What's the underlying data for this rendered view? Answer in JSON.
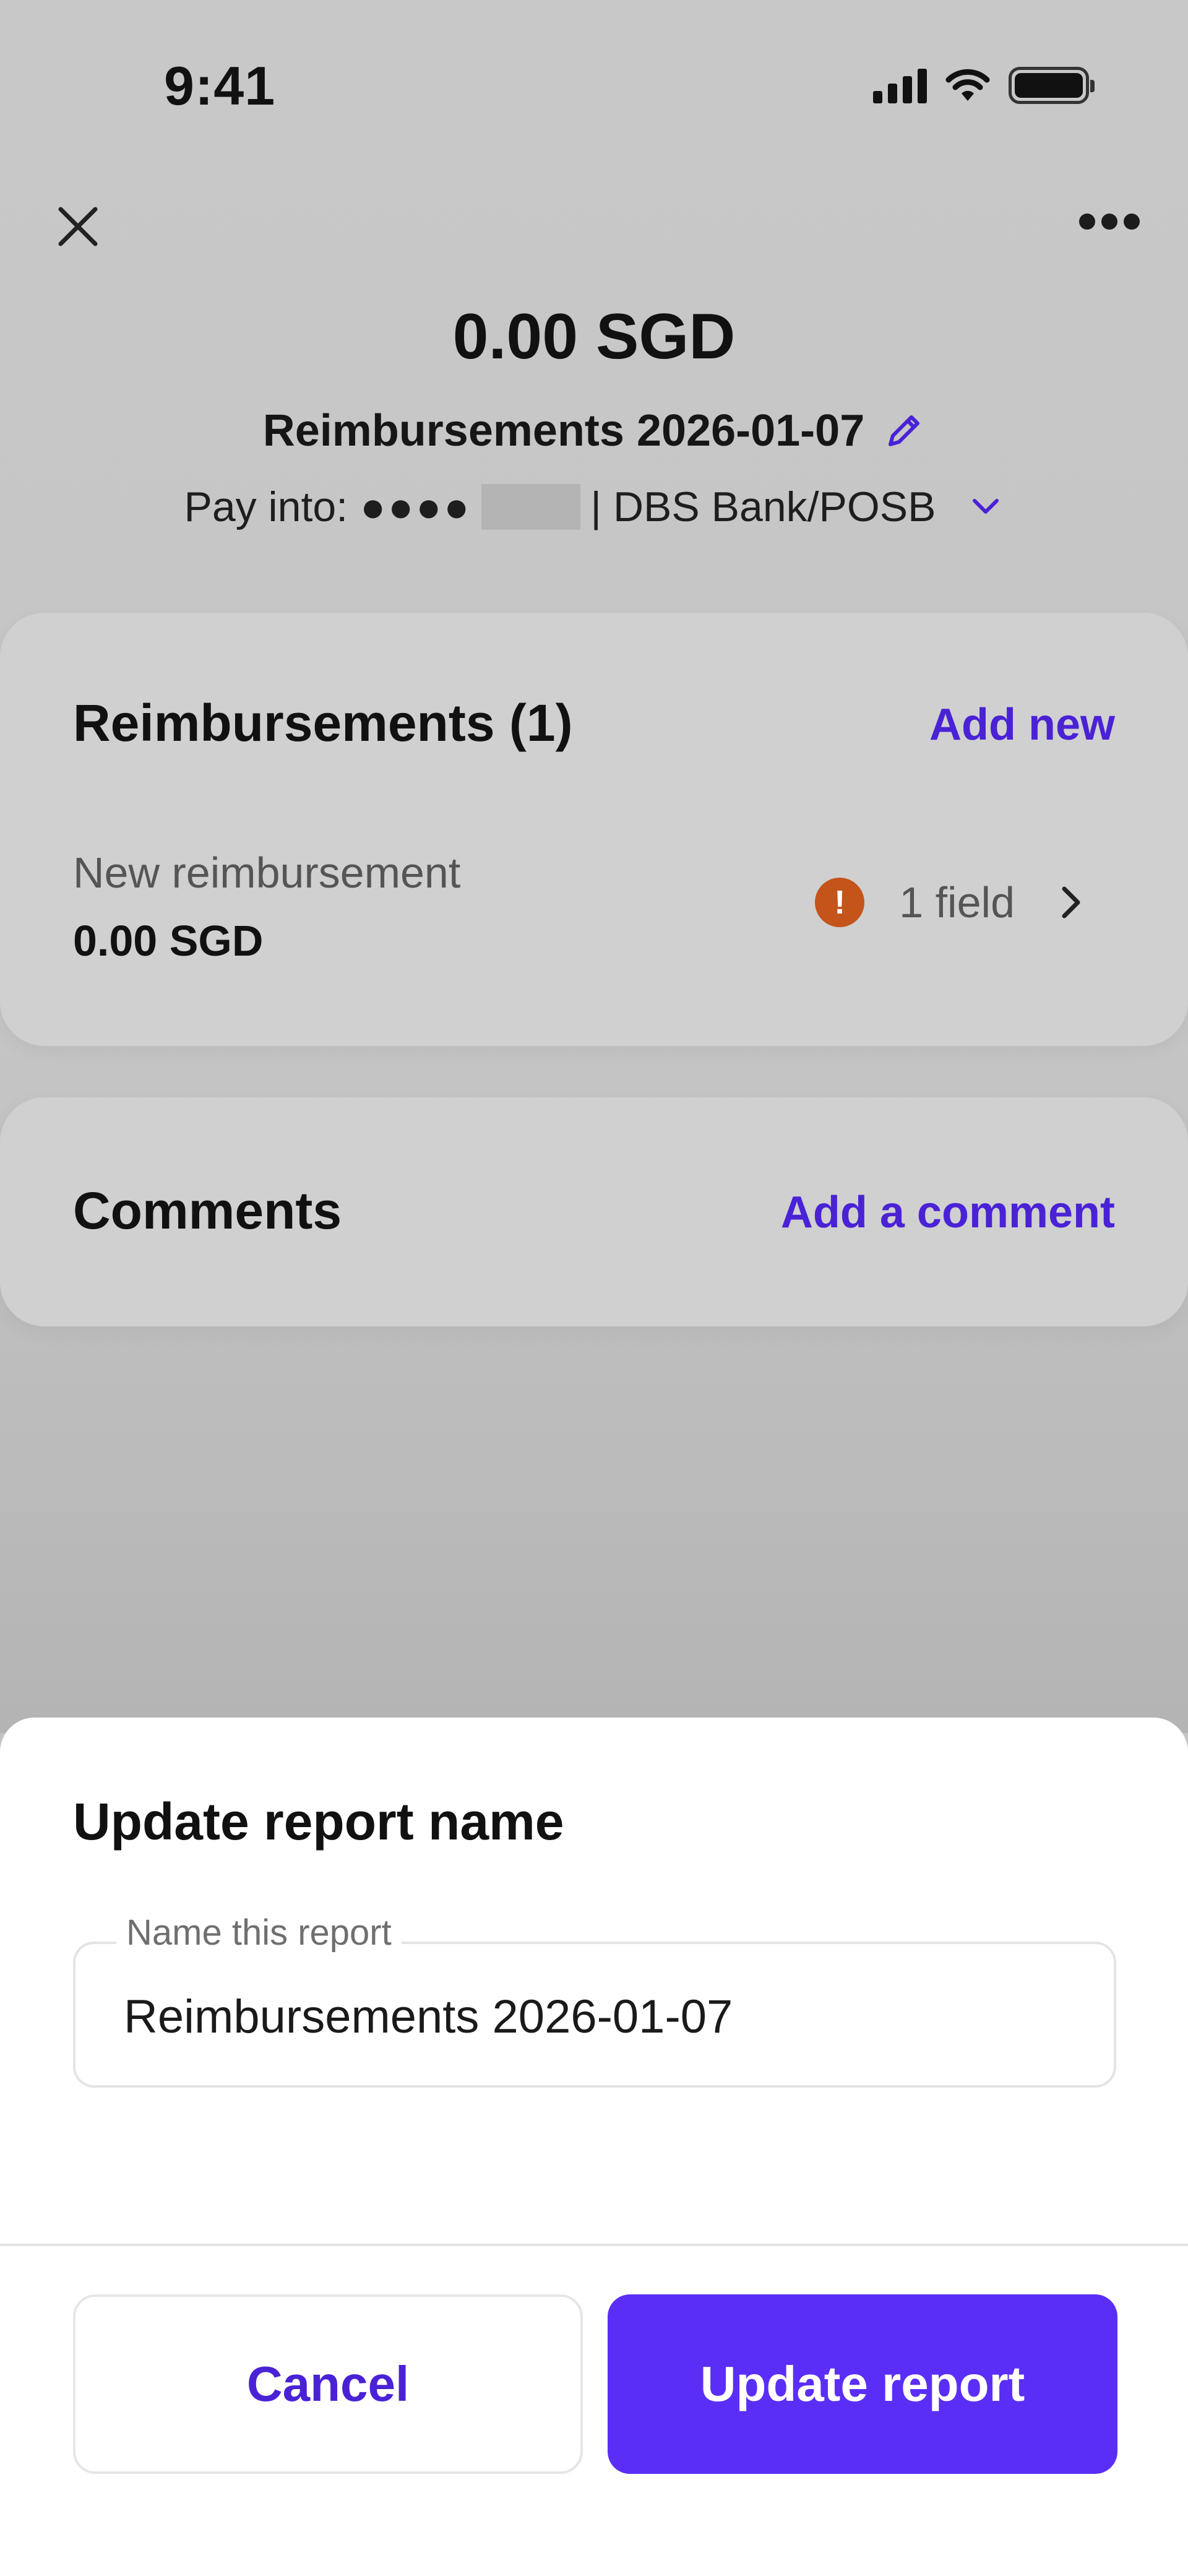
{
  "status_bar": {
    "time": "9:41",
    "icons": [
      "cellular-signal-icon",
      "wifi-icon",
      "battery-icon"
    ]
  },
  "header": {
    "close_icon": "close-icon",
    "more_icon": "more-options-icon",
    "amount": "0.00 SGD",
    "report_name": "Reimbursements 2026-01-07",
    "edit_icon": "pencil-icon",
    "pay_into_label": "Pay into:",
    "masked_account": "●●●●",
    "bank": "| DBS Bank/POSB",
    "dropdown_icon": "chevron-down-icon"
  },
  "reimbursements": {
    "heading": "Reimbursements (1)",
    "add_link": "Add new",
    "items": [
      {
        "label": "New reimbursement",
        "amount": "0.00 SGD",
        "status_text": "1 field",
        "status_icon": "warning-icon",
        "warning_glyph": "!"
      }
    ]
  },
  "comments": {
    "heading": "Comments",
    "add_link": "Add a comment"
  },
  "sheet": {
    "title": "Update report name",
    "field_label": "Name this report",
    "field_value": "Reimbursements 2026-01-07",
    "cancel_label": "Cancel",
    "submit_label": "Update report"
  },
  "colors": {
    "accent": "#5b2ef7",
    "link": "#4a22d6",
    "warning": "#c4541a",
    "overlay_bg": "#c4c4c4",
    "card_bg": "#d0d0d0"
  }
}
